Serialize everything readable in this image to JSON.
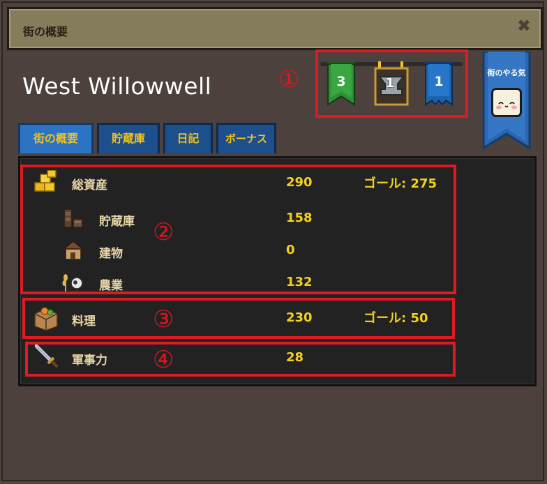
{
  "window": {
    "title": "街の概要",
    "close_glyph": "✖",
    "town_name": "West Willowwell"
  },
  "banners": [
    {
      "value": "3",
      "color": "#2e8f34",
      "icon": "green-banner-icon"
    },
    {
      "value": "1",
      "color": "#6b5c45",
      "icon": "anvil-banner-icon"
    },
    {
      "value": "1",
      "color": "#1e62ad",
      "icon": "blue-banner-icon"
    }
  ],
  "motivation": {
    "label": "街のやる気",
    "face_icon": "happy-face-icon"
  },
  "tabs": [
    {
      "label": "街の概要",
      "active": true
    },
    {
      "label": "貯蔵庫",
      "active": false
    },
    {
      "label": "日記",
      "active": false
    },
    {
      "label": "ボーナス",
      "active": false
    }
  ],
  "annotations": [
    "①",
    "②",
    "③",
    "④"
  ],
  "stats": {
    "total_assets": {
      "label": "総資産",
      "value": "290",
      "gold_label": "ゴール: 275",
      "icon": "gold-bars-icon"
    },
    "storage": {
      "label": "貯蔵庫",
      "value": "158",
      "icon": "shelf-icon"
    },
    "buildings": {
      "label": "建物",
      "value": "0",
      "icon": "house-icon"
    },
    "agriculture": {
      "label": "農業",
      "value": "132",
      "icon": "farm-icon"
    },
    "cooking": {
      "label": "料理",
      "value": "230",
      "gold_label": "ゴール: 50",
      "icon": "food-crate-icon"
    },
    "military": {
      "label": "軍事力",
      "value": "28",
      "icon": "sword-icon"
    }
  },
  "colors": {
    "accent_gold": "#f5d11d",
    "tab_blue": "#2d73c4",
    "annotation_red": "#dd1b22"
  }
}
